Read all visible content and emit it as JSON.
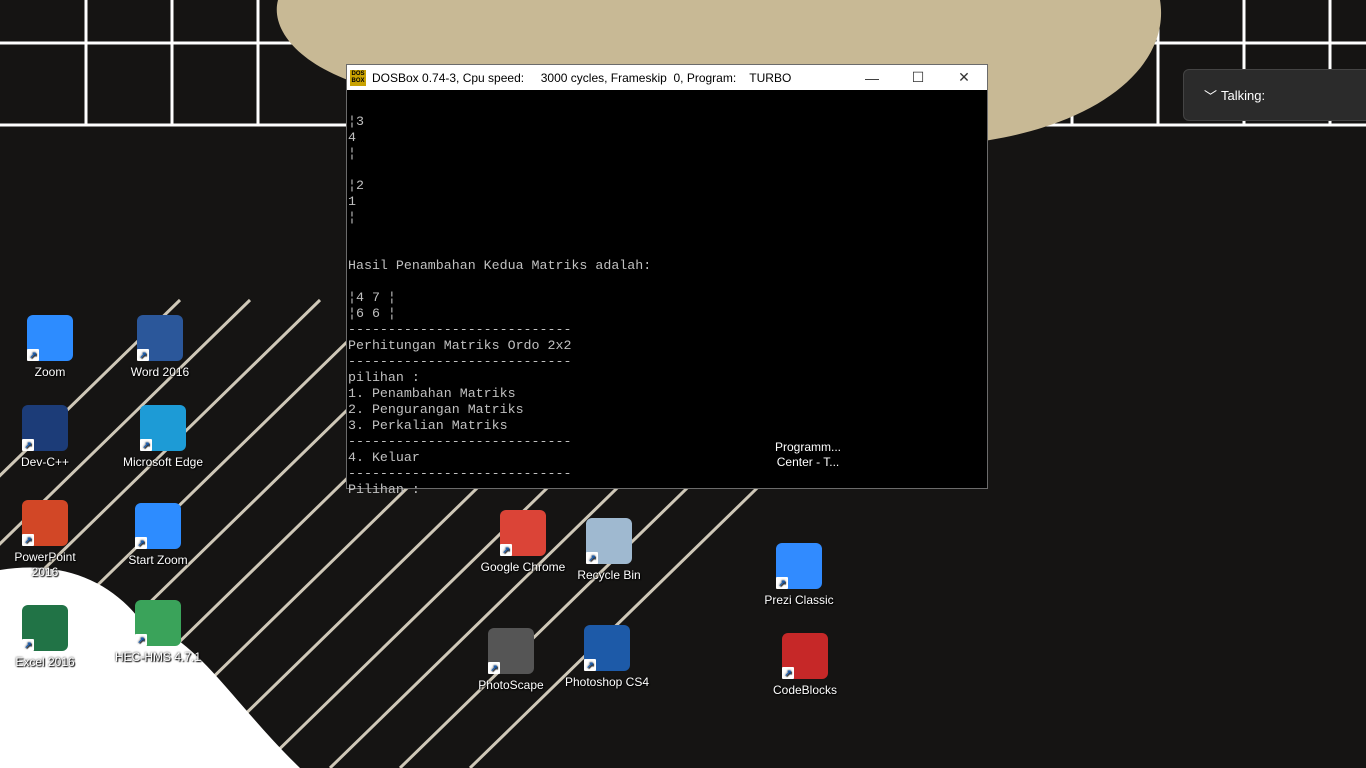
{
  "window": {
    "title": "DOSBox 0.74-3, Cpu speed:     3000 cycles, Frameskip  0, Program:    TURBO",
    "minimize": "—",
    "maximize": "☐",
    "close": "✕"
  },
  "terminal": {
    "lines": [
      "",
      "¦3",
      "4",
      "¦",
      "",
      "¦2",
      "1",
      "¦",
      "",
      "",
      "Hasil Penambahan Kedua Matriks adalah:",
      "",
      "¦4 7 ¦",
      "¦6 6 ¦",
      "----------------------------",
      "Perhitungan Matriks Ordo 2x2",
      "----------------------------",
      "pilihan :",
      "1. Penambahan Matriks",
      "2. Pengurangan Matriks",
      "3. Perkalian Matriks",
      "----------------------------",
      "4. Keluar",
      "----------------------------",
      "Pilihan :"
    ]
  },
  "talking": {
    "label": "Talking:"
  },
  "desktop_icons": [
    {
      "label": "Zoom",
      "icon": "zoom-icon",
      "color": "#2d8cff"
    },
    {
      "label": "Word 2016",
      "icon": "word-icon",
      "color": "#2b579a"
    },
    {
      "label": "Dev-C++",
      "icon": "devcpp-icon",
      "color": "#1c3c78"
    },
    {
      "label": "Microsoft Edge",
      "icon": "edge-icon",
      "color": "#1d9bd6"
    },
    {
      "label": "PowerPoint 2016",
      "icon": "powerpoint-icon",
      "color": "#d24726"
    },
    {
      "label": "Start Zoom",
      "icon": "zoom-icon",
      "color": "#2d8cff"
    },
    {
      "label": "Excel 2016",
      "icon": "excel-icon",
      "color": "#217346"
    },
    {
      "label": "HEC-HMS 4.7.1",
      "icon": "hec-hms-icon",
      "color": "#3aa35a"
    },
    {
      "label": "Google Chrome",
      "icon": "chrome-icon",
      "color": "#db4437"
    },
    {
      "label": "Recycle Bin",
      "icon": "recycle-bin-icon",
      "color": "#9fb9d0"
    },
    {
      "label": "PhotoScape",
      "icon": "photoscape-icon",
      "color": "#555"
    },
    {
      "label": "Photoshop CS4",
      "icon": "photoshop-icon",
      "color": "#1d5aa8"
    },
    {
      "label": "Programm... Center -  T...",
      "icon": "program-center-icon",
      "color": ""
    },
    {
      "label": "Prezi Classic",
      "icon": "prezi-icon",
      "color": "#318bff"
    },
    {
      "label": "CodeBlocks",
      "icon": "codeblocks-icon",
      "color": "#c62828"
    }
  ]
}
